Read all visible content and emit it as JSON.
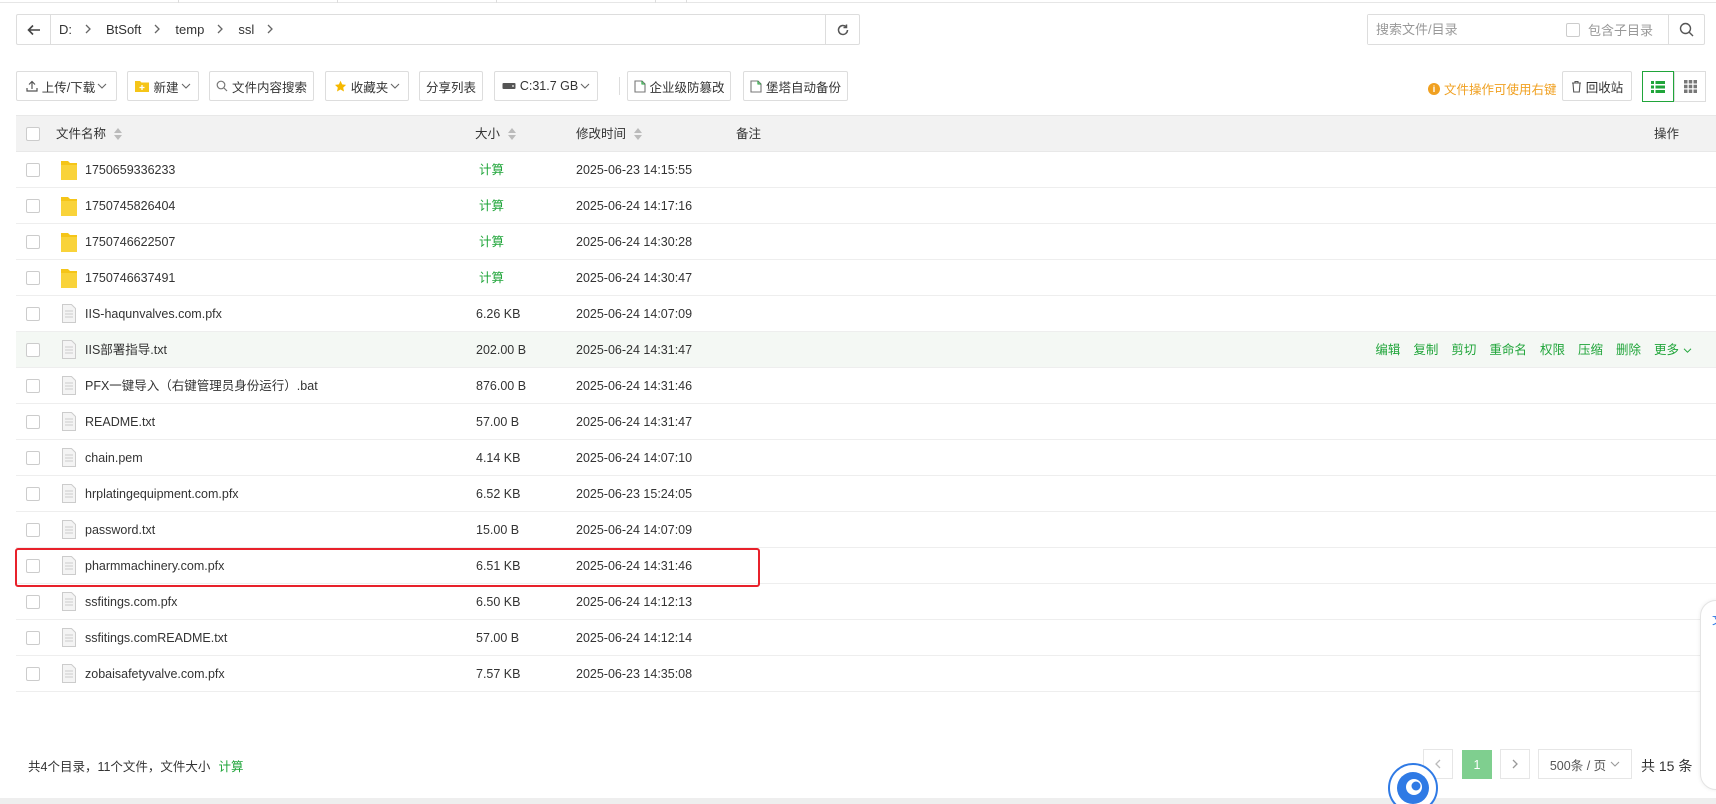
{
  "address": {
    "crumbs": [
      "D:",
      "BtSoft",
      "temp",
      "ssl"
    ]
  },
  "search": {
    "placeholder": "搜索文件/目录",
    "include_sub_label": "包含子目录"
  },
  "toolbar": {
    "upload": "上传/下载",
    "new": "新建",
    "content_search": "文件内容搜索",
    "favorites": "收藏夹",
    "share_list": "分享列表",
    "disk": "C:31.7 GB",
    "tamper": "企业级防篡改",
    "backup": "堡塔自动备份",
    "hint": "文件操作可使用右键",
    "recycle": "回收站"
  },
  "table": {
    "headers": {
      "name": "文件名称",
      "size": "大小",
      "mtime": "修改时间",
      "note": "备注",
      "ops": "操作"
    },
    "rows": [
      {
        "name": "1750659336233",
        "type": "folder",
        "size": "计算",
        "mtime": "2025-06-23 14:15:55"
      },
      {
        "name": "1750745826404",
        "type": "folder",
        "size": "计算",
        "mtime": "2025-06-24 14:17:16"
      },
      {
        "name": "1750746622507",
        "type": "folder",
        "size": "计算",
        "mtime": "2025-06-24 14:30:28"
      },
      {
        "name": "1750746637491",
        "type": "folder",
        "size": "计算",
        "mtime": "2025-06-24 14:30:47"
      },
      {
        "name": "IIS-haqunvalves.com.pfx",
        "type": "file",
        "size": "6.26 KB",
        "mtime": "2025-06-24 14:07:09"
      },
      {
        "name": "IIS部署指导.txt",
        "type": "file",
        "size": "202.00 B",
        "mtime": "2025-06-24 14:31:47"
      },
      {
        "name": "PFX一键导入（右键管理员身份运行）.bat",
        "type": "file",
        "size": "876.00 B",
        "mtime": "2025-06-24 14:31:46"
      },
      {
        "name": "README.txt",
        "type": "file",
        "size": "57.00 B",
        "mtime": "2025-06-24 14:31:47"
      },
      {
        "name": "chain.pem",
        "type": "file",
        "size": "4.14 KB",
        "mtime": "2025-06-24 14:07:10"
      },
      {
        "name": "hrplatingequipment.com.pfx",
        "type": "file",
        "size": "6.52 KB",
        "mtime": "2025-06-23 15:24:05"
      },
      {
        "name": "password.txt",
        "type": "file",
        "size": "15.00 B",
        "mtime": "2025-06-24 14:07:09"
      },
      {
        "name": "pharmmachinery.com.pfx",
        "type": "file",
        "size": "6.51 KB",
        "mtime": "2025-06-24 14:31:46"
      },
      {
        "name": "ssfitings.com.pfx",
        "type": "file",
        "size": "6.50 KB",
        "mtime": "2025-06-24 14:12:13"
      },
      {
        "name": "ssfitings.comREADME.txt",
        "type": "file",
        "size": "57.00 B",
        "mtime": "2025-06-24 14:12:14"
      },
      {
        "name": "zobaisafetyvalve.com.pfx",
        "type": "file",
        "size": "7.57 KB",
        "mtime": "2025-06-23 14:35:08"
      }
    ],
    "row_actions": [
      "编辑",
      "复制",
      "剪切",
      "重命名",
      "权限",
      "压缩",
      "删除",
      "更多"
    ]
  },
  "footer": {
    "summary": "共4个目录，11个文件，文件大小",
    "calc": "计算",
    "current_page": "1",
    "per_page": "500条 / 页",
    "total": "共 15 条"
  },
  "side_tab": {
    "label": "文"
  },
  "colors": {
    "accent": "#20a53a",
    "warning": "#f0a020",
    "highlight_box": "#e8212b"
  }
}
